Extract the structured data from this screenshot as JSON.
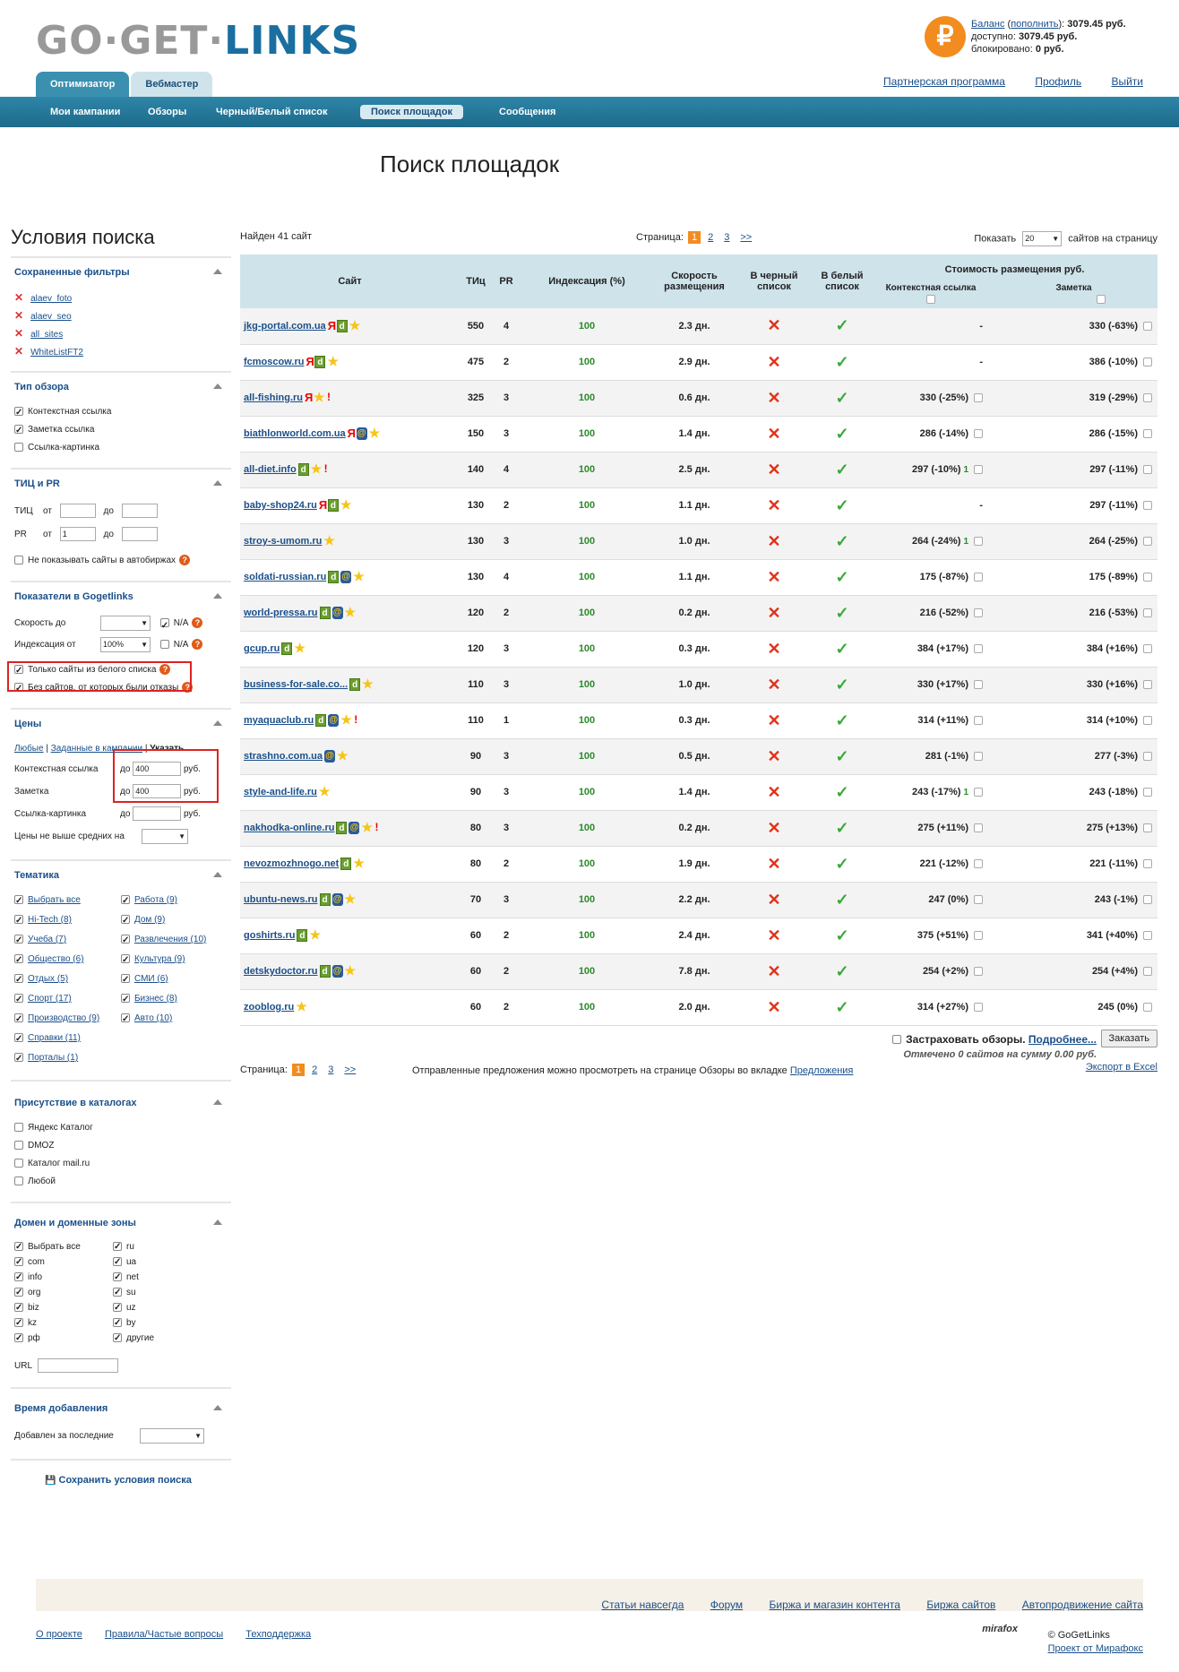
{
  "logo": {
    "part1": "GO·GET·",
    "part2": "LINKS"
  },
  "balance": {
    "label": "Баланс",
    "topup": "пополнить",
    "amount": "3079.45 руб.",
    "available_label": "доступно:",
    "available": "3079.45 руб.",
    "blocked_label": "блокировано:",
    "blocked": "0 руб.",
    "icon": "₽"
  },
  "tabs": [
    "Оптимизатор",
    "Вебмастер"
  ],
  "top_links": [
    "Партнерская программа",
    "Профиль",
    "Выйти"
  ],
  "nav": [
    "Мои кампании",
    "Обзоры",
    "Черный/Белый список",
    "Поиск площадок",
    "Сообщения"
  ],
  "page_title": "Поиск площадок",
  "sidebar": {
    "title": "Условия поиска",
    "saved_filters": {
      "header": "Сохраненные фильтры",
      "items": [
        "alaev_foto",
        "alaev_seo",
        "all_sites",
        "WhiteListFT2"
      ]
    },
    "review_type": {
      "header": "Тип обзора",
      "items": [
        "Контекстная ссылка",
        "Заметка ссылка",
        "Ссылка-картинка"
      ]
    },
    "tic_pr": {
      "header": "ТИЦ и PR",
      "tic": "ТИЦ",
      "pr": "PR",
      "from": "от",
      "to": "до",
      "pr_from": "1",
      "no_auto": "Не показывать сайты в автобиржах"
    },
    "gogetlinks": {
      "header": "Показатели в Gogetlinks",
      "speed": "Скорость до",
      "na": "N/A",
      "index": "Индексация от",
      "index_val": "100%",
      "white_only": "Только сайты из белого списка",
      "no_refusals": "Без сайтов, от которых были отказы"
    },
    "prices": {
      "header": "Цены",
      "modes": [
        "Любые",
        "Заданные в кампании",
        "Указать"
      ],
      "context": "Контекстная ссылка",
      "note": "Заметка",
      "image": "Ссылка-картинка",
      "to": "до",
      "rub": "руб.",
      "context_val": "400",
      "note_val": "400",
      "not_above": "Цены не выше средних на"
    },
    "topics": {
      "header": "Тематика",
      "left": [
        "Выбрать все",
        "Hi-Tech (8)",
        "Учеба (7)",
        "Общество (6)",
        "Отдых (5)",
        "Спорт (17)",
        "Производство (9)",
        "Справки (11)",
        "Порталы (1)"
      ],
      "right": [
        "Работа (9)",
        "Дом (9)",
        "Развлечения (10)",
        "Культура (9)",
        "СМИ (6)",
        "Бизнес (8)",
        "Авто (10)"
      ]
    },
    "catalogs": {
      "header": "Присутствие в каталогах",
      "items": [
        "Яндекс Каталог",
        "DMOZ",
        "Каталог mail.ru",
        "Любой"
      ]
    },
    "domains": {
      "header": "Домен и доменные зоны",
      "left": [
        "Выбрать все",
        "com",
        "info",
        "org",
        "biz",
        "kz",
        "рф"
      ],
      "right": [
        "ru",
        "ua",
        "net",
        "su",
        "uz",
        "by",
        "другие"
      ],
      "url": "URL"
    },
    "added": {
      "header": "Время добавления",
      "label": "Добавлен за последние"
    },
    "save": "Сохранить условия поиска"
  },
  "main": {
    "found": "Найден 41 сайт",
    "page_label": "Страница:",
    "pages": [
      "1",
      "2",
      "3",
      ">>"
    ],
    "show_label": "Показать",
    "per_page": "20",
    "per_page_suffix": "сайтов на страницу",
    "columns": {
      "site": "Сайт",
      "tic": "ТИц",
      "pr": "PR",
      "index": "Индексация (%)",
      "speed": "Скорость размещения",
      "black": "В черный список",
      "white": "В белый список",
      "cost": "Стоимость размещения руб.",
      "context": "Контекстная ссылка",
      "note": "Заметка"
    },
    "rows": [
      {
        "site": "jkg-portal.com.ua",
        "icons": [
          "y",
          "d",
          "star"
        ],
        "tic": "550",
        "pr": "4",
        "idx": "100",
        "speed": "2.3 дн.",
        "context": "-",
        "note": "330 (-63%)"
      },
      {
        "site": "fcmoscow.ru",
        "icons": [
          "y",
          "d",
          "star"
        ],
        "tic": "475",
        "pr": "2",
        "idx": "100",
        "speed": "2.9 дн.",
        "context": "-",
        "note": "386 (-10%)"
      },
      {
        "site": "all-fishing.ru",
        "icons": [
          "y",
          "star",
          "ex"
        ],
        "tic": "325",
        "pr": "3",
        "idx": "100",
        "speed": "0.6 дн.",
        "context": "330 (-25%)",
        "note": "319 (-29%)"
      },
      {
        "site": "biathlonworld.com.ua",
        "icons": [
          "y",
          "g",
          "star"
        ],
        "tic": "150",
        "pr": "3",
        "idx": "100",
        "speed": "1.4 дн.",
        "context": "286 (-14%)",
        "note": "286 (-15%)"
      },
      {
        "site": "all-diet.info",
        "icons": [
          "d",
          "star",
          "ex"
        ],
        "tic": "140",
        "pr": "4",
        "idx": "100",
        "speed": "2.5 дн.",
        "context": "297 (-10%)",
        "ctx_one": "1",
        "note": "297 (-11%)"
      },
      {
        "site": "baby-shop24.ru",
        "icons": [
          "y",
          "d",
          "star"
        ],
        "tic": "130",
        "pr": "2",
        "idx": "100",
        "speed": "1.1 дн.",
        "context": "-",
        "note": "297 (-11%)"
      },
      {
        "site": "stroy-s-umom.ru",
        "icons": [
          "star"
        ],
        "tic": "130",
        "pr": "3",
        "idx": "100",
        "speed": "1.0 дн.",
        "context": "264 (-24%)",
        "ctx_one": "1",
        "note": "264 (-25%)"
      },
      {
        "site": "soldati-russian.ru",
        "icons": [
          "d",
          "g",
          "star"
        ],
        "tic": "130",
        "pr": "4",
        "idx": "100",
        "speed": "1.1 дн.",
        "context": "175 (-87%)",
        "note": "175 (-89%)"
      },
      {
        "site": "world-pressa.ru",
        "icons": [
          "d",
          "g",
          "star"
        ],
        "tic": "120",
        "pr": "2",
        "idx": "100",
        "speed": "0.2 дн.",
        "context": "216 (-52%)",
        "note": "216 (-53%)"
      },
      {
        "site": "gcup.ru",
        "icons": [
          "d",
          "star"
        ],
        "tic": "120",
        "pr": "3",
        "idx": "100",
        "speed": "0.3 дн.",
        "context": "384 (+17%)",
        "note": "384 (+16%)"
      },
      {
        "site": "business-for-sale.co...",
        "icons": [
          "d",
          "star"
        ],
        "tic": "110",
        "pr": "3",
        "idx": "100",
        "speed": "1.0 дн.",
        "context": "330 (+17%)",
        "note": "330 (+16%)"
      },
      {
        "site": "myaquaclub.ru",
        "icons": [
          "d",
          "g",
          "star",
          "ex"
        ],
        "tic": "110",
        "pr": "1",
        "idx": "100",
        "speed": "0.3 дн.",
        "context": "314 (+11%)",
        "note": "314 (+10%)"
      },
      {
        "site": "strashno.com.ua",
        "icons": [
          "g",
          "star"
        ],
        "tic": "90",
        "pr": "3",
        "idx": "100",
        "speed": "0.5 дн.",
        "context": "281 (-1%)",
        "note": "277 (-3%)"
      },
      {
        "site": "style-and-life.ru",
        "icons": [
          "star"
        ],
        "tic": "90",
        "pr": "3",
        "idx": "100",
        "speed": "1.4 дн.",
        "context": "243 (-17%)",
        "ctx_one": "1",
        "note": "243 (-18%)"
      },
      {
        "site": "nakhodka-online.ru",
        "icons": [
          "d",
          "g",
          "star",
          "ex"
        ],
        "tic": "80",
        "pr": "3",
        "idx": "100",
        "speed": "0.2 дн.",
        "context": "275 (+11%)",
        "note": "275 (+13%)"
      },
      {
        "site": "nevozmozhnogo.net",
        "icons": [
          "d",
          "star"
        ],
        "tic": "80",
        "pr": "2",
        "idx": "100",
        "speed": "1.9 дн.",
        "context": "221 (-12%)",
        "note": "221 (-11%)"
      },
      {
        "site": "ubuntu-news.ru",
        "icons": [
          "d",
          "g",
          "star"
        ],
        "tic": "70",
        "pr": "3",
        "idx": "100",
        "speed": "2.2 дн.",
        "context": "247 (0%)",
        "note": "243 (-1%)"
      },
      {
        "site": "goshirts.ru",
        "icons": [
          "d",
          "star"
        ],
        "tic": "60",
        "pr": "2",
        "idx": "100",
        "speed": "2.4 дн.",
        "context": "375 (+51%)",
        "note": "341 (+40%)"
      },
      {
        "site": "detskydoctor.ru",
        "icons": [
          "d",
          "g",
          "star"
        ],
        "tic": "60",
        "pr": "2",
        "idx": "100",
        "speed": "7.8 дн.",
        "context": "254 (+2%)",
        "note": "254 (+4%)"
      },
      {
        "site": "zooblog.ru",
        "icons": [
          "star"
        ],
        "tic": "60",
        "pr": "2",
        "idx": "100",
        "speed": "2.0 дн.",
        "context": "314 (+27%)",
        "note": "245 (0%)"
      }
    ],
    "insure": "Застраховать обзоры.",
    "more": "Подробнее...",
    "order": "Заказать",
    "marked": "Отмечено 0 сайтов на сумму 0.00 руб.",
    "sent_note": "Отправленные предложения можно просмотреть на странице Обзоры во вкладке",
    "sent_link": "Предложения",
    "export": "Экспорт в Excel"
  },
  "footer": {
    "links": [
      "Статьи навсегда",
      "Форум",
      "Биржа и магазин контента",
      "Биржа сайтов",
      "Автопродвижение сайта"
    ],
    "bottom": [
      "О проекте",
      "Правила/Частые вопросы",
      "Техподдержка"
    ],
    "copyright": "© GoGetLinks",
    "project": "Проект от Мирафокс",
    "mirafox": "mirafox"
  }
}
